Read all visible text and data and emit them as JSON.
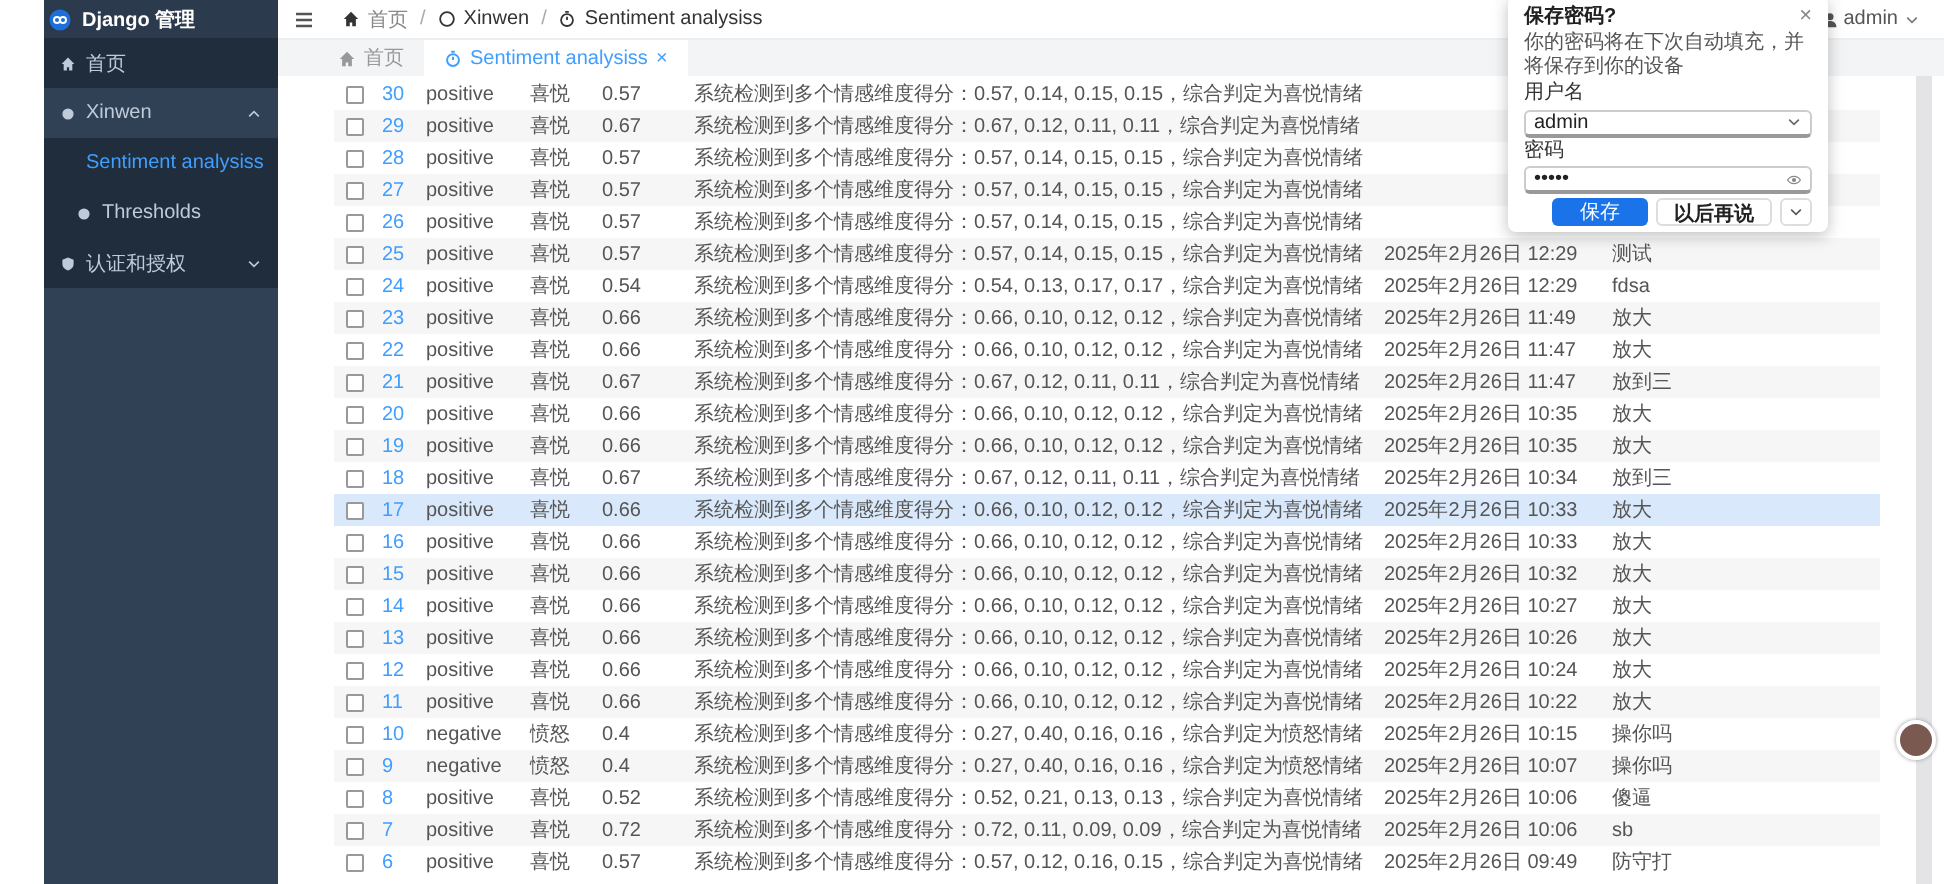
{
  "sidebar": {
    "logo": "Django 管理",
    "items": [
      {
        "label": "首页",
        "selected": false
      },
      {
        "label": "Xinwen",
        "selected": false,
        "expanded": true,
        "children": [
          {
            "label": "Sentiment analysiss",
            "selected": true
          },
          {
            "label": "Thresholds",
            "selected": false
          }
        ]
      },
      {
        "label": "认证和授权",
        "selected": false,
        "expanded": false
      }
    ]
  },
  "header": {
    "breadcrumb": [
      "首页",
      "Xinwen",
      "Sentiment analysiss"
    ],
    "separator": "/",
    "user": "admin"
  },
  "tabs": [
    {
      "label": "首页",
      "selected": false
    },
    {
      "label": "Sentiment analysiss",
      "selected": true,
      "close": "×"
    }
  ],
  "table": {
    "rows": [
      {
        "id": "30",
        "sentiment": "positive",
        "emotion": "喜悦",
        "score": "0.57",
        "description": "系统检测到多个情感维度得分：0.57, 0.14, 0.15, 0.15，综合判定为喜悦情绪",
        "checked": false,
        "selected": false
      },
      {
        "id": "29",
        "sentiment": "positive",
        "emotion": "喜悦",
        "score": "0.67",
        "description": "系统检测到多个情感维度得分：0.67, 0.12, 0.11, 0.11，综合判定为喜悦情绪",
        "checked": false,
        "selected": false
      },
      {
        "id": "28",
        "sentiment": "positive",
        "emotion": "喜悦",
        "score": "0.57",
        "description": "系统检测到多个情感维度得分：0.57, 0.14, 0.15, 0.15，综合判定为喜悦情绪",
        "checked": false,
        "selected": false
      },
      {
        "id": "27",
        "sentiment": "positive",
        "emotion": "喜悦",
        "score": "0.57",
        "description": "系统检测到多个情感维度得分：0.57, 0.14, 0.15, 0.15，综合判定为喜悦情绪",
        "checked": false,
        "selected": false
      },
      {
        "id": "26",
        "sentiment": "positive",
        "emotion": "喜悦",
        "score": "0.57",
        "description": "系统检测到多个情感维度得分：0.57, 0.14, 0.15, 0.15，综合判定为喜悦情绪",
        "checked": false,
        "selected": false
      },
      {
        "id": "25",
        "sentiment": "positive",
        "emotion": "喜悦",
        "score": "0.57",
        "description": "系统检测到多个情感维度得分：0.57, 0.14, 0.15, 0.15，综合判定为喜悦情绪",
        "time": "2025年2月26日 12:29",
        "text": "测试",
        "checked": false,
        "selected": false
      },
      {
        "id": "24",
        "sentiment": "positive",
        "emotion": "喜悦",
        "score": "0.54",
        "description": "系统检测到多个情感维度得分：0.54, 0.13, 0.17, 0.17，综合判定为喜悦情绪",
        "time": "2025年2月26日 12:29",
        "text": "fdsa",
        "checked": false,
        "selected": false
      },
      {
        "id": "23",
        "sentiment": "positive",
        "emotion": "喜悦",
        "score": "0.66",
        "description": "系统检测到多个情感维度得分：0.66, 0.10, 0.12, 0.12，综合判定为喜悦情绪",
        "time": "2025年2月26日 11:49",
        "text": "放大",
        "checked": false,
        "selected": false
      },
      {
        "id": "22",
        "sentiment": "positive",
        "emotion": "喜悦",
        "score": "0.66",
        "description": "系统检测到多个情感维度得分：0.66, 0.10, 0.12, 0.12，综合判定为喜悦情绪",
        "time": "2025年2月26日 11:47",
        "text": "放大",
        "checked": false,
        "selected": false
      },
      {
        "id": "21",
        "sentiment": "positive",
        "emotion": "喜悦",
        "score": "0.67",
        "description": "系统检测到多个情感维度得分：0.67, 0.12, 0.11, 0.11，综合判定为喜悦情绪",
        "time": "2025年2月26日 11:47",
        "text": "放到三",
        "checked": false,
        "selected": false
      },
      {
        "id": "20",
        "sentiment": "positive",
        "emotion": "喜悦",
        "score": "0.66",
        "description": "系统检测到多个情感维度得分：0.66, 0.10, 0.12, 0.12，综合判定为喜悦情绪",
        "time": "2025年2月26日 10:35",
        "text": "放大",
        "checked": false,
        "selected": false
      },
      {
        "id": "19",
        "sentiment": "positive",
        "emotion": "喜悦",
        "score": "0.66",
        "description": "系统检测到多个情感维度得分：0.66, 0.10, 0.12, 0.12，综合判定为喜悦情绪",
        "time": "2025年2月26日 10:35",
        "text": "放大",
        "checked": false,
        "selected": false
      },
      {
        "id": "18",
        "sentiment": "positive",
        "emotion": "喜悦",
        "score": "0.67",
        "description": "系统检测到多个情感维度得分：0.67, 0.12, 0.11, 0.11，综合判定为喜悦情绪",
        "time": "2025年2月26日 10:34",
        "text": "放到三",
        "checked": false,
        "selected": false
      },
      {
        "id": "17",
        "sentiment": "positive",
        "emotion": "喜悦",
        "score": "0.66",
        "description": "系统检测到多个情感维度得分：0.66, 0.10, 0.12, 0.12，综合判定为喜悦情绪",
        "time": "2025年2月26日 10:33",
        "text": "放大",
        "checked": false,
        "selected": true
      },
      {
        "id": "16",
        "sentiment": "positive",
        "emotion": "喜悦",
        "score": "0.66",
        "description": "系统检测到多个情感维度得分：0.66, 0.10, 0.12, 0.12，综合判定为喜悦情绪",
        "time": "2025年2月26日 10:33",
        "text": "放大",
        "checked": false,
        "selected": false
      },
      {
        "id": "15",
        "sentiment": "positive",
        "emotion": "喜悦",
        "score": "0.66",
        "description": "系统检测到多个情感维度得分：0.66, 0.10, 0.12, 0.12，综合判定为喜悦情绪",
        "time": "2025年2月26日 10:32",
        "text": "放大",
        "checked": false,
        "selected": false
      },
      {
        "id": "14",
        "sentiment": "positive",
        "emotion": "喜悦",
        "score": "0.66",
        "description": "系统检测到多个情感维度得分：0.66, 0.10, 0.12, 0.12，综合判定为喜悦情绪",
        "time": "2025年2月26日 10:27",
        "text": "放大",
        "checked": false,
        "selected": false
      },
      {
        "id": "13",
        "sentiment": "positive",
        "emotion": "喜悦",
        "score": "0.66",
        "description": "系统检测到多个情感维度得分：0.66, 0.10, 0.12, 0.12，综合判定为喜悦情绪",
        "time": "2025年2月26日 10:26",
        "text": "放大",
        "checked": false,
        "selected": false
      },
      {
        "id": "12",
        "sentiment": "positive",
        "emotion": "喜悦",
        "score": "0.66",
        "description": "系统检测到多个情感维度得分：0.66, 0.10, 0.12, 0.12，综合判定为喜悦情绪",
        "time": "2025年2月26日 10:24",
        "text": "放大",
        "checked": false,
        "selected": false
      },
      {
        "id": "11",
        "sentiment": "positive",
        "emotion": "喜悦",
        "score": "0.66",
        "description": "系统检测到多个情感维度得分：0.66, 0.10, 0.12, 0.12，综合判定为喜悦情绪",
        "time": "2025年2月26日 10:22",
        "text": "放大",
        "checked": false,
        "selected": false
      },
      {
        "id": "10",
        "sentiment": "negative",
        "emotion": "愤怒",
        "score": "0.4",
        "description": "系统检测到多个情感维度得分：0.27, 0.40, 0.16, 0.16，综合判定为愤怒情绪",
        "time": "2025年2月26日 10:15",
        "text": "操你吗",
        "checked": false,
        "selected": false
      },
      {
        "id": "9",
        "sentiment": "negative",
        "emotion": "愤怒",
        "score": "0.4",
        "description": "系统检测到多个情感维度得分：0.27, 0.40, 0.16, 0.16，综合判定为愤怒情绪",
        "time": "2025年2月26日 10:07",
        "text": "操你吗",
        "checked": false,
        "selected": false
      },
      {
        "id": "8",
        "sentiment": "positive",
        "emotion": "喜悦",
        "score": "0.52",
        "description": "系统检测到多个情感维度得分：0.52, 0.21, 0.13, 0.13，综合判定为喜悦情绪",
        "time": "2025年2月26日 10:06",
        "text": "傻逼",
        "checked": false,
        "selected": false
      },
      {
        "id": "7",
        "sentiment": "positive",
        "emotion": "喜悦",
        "score": "0.72",
        "description": "系统检测到多个情感维度得分：0.72, 0.11, 0.09, 0.09，综合判定为喜悦情绪",
        "time": "2025年2月26日 10:06",
        "text": "sb",
        "checked": false,
        "selected": false
      },
      {
        "id": "6",
        "sentiment": "positive",
        "emotion": "喜悦",
        "score": "0.57",
        "description": "系统检测到多个情感维度得分：0.57, 0.12, 0.16, 0.15，综合判定为喜悦情绪",
        "time": "2025年2月26日 09:49",
        "text": "防守打",
        "checked": false,
        "selected": false
      }
    ]
  },
  "save_password_popup": {
    "title": "保存密码?",
    "close": "×",
    "message": "你的密码将在下次自动填充，并将保存到你的设备",
    "username_label": "用户名",
    "username": "admin",
    "password_label": "密码",
    "password": "•••••",
    "save": "保存",
    "later": "以后再说"
  }
}
